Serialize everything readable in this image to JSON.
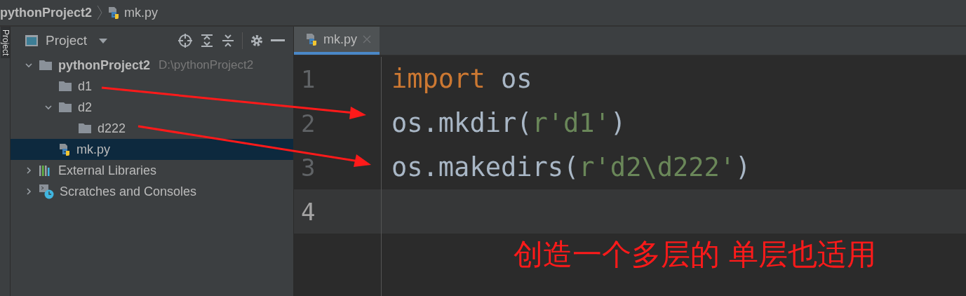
{
  "breadcrumb": {
    "project": "pythonProject2",
    "file": "mk.py"
  },
  "side_strip": {
    "label": "Project"
  },
  "project_panel": {
    "title": "Project",
    "tree": [
      {
        "label": "pythonProject2",
        "hint": "D:\\pythonProject2",
        "kind": "root",
        "expanded": true,
        "selected": false,
        "children": [
          {
            "label": "d1",
            "kind": "folder",
            "selected": false
          },
          {
            "label": "d2",
            "kind": "folder",
            "expanded": true,
            "selected": false,
            "children": [
              {
                "label": "d222",
                "kind": "folder",
                "selected": false
              }
            ]
          },
          {
            "label": "mk.py",
            "kind": "python",
            "selected": true
          }
        ]
      },
      {
        "label": "External Libraries",
        "kind": "libraries",
        "expanded": false,
        "selected": false
      },
      {
        "label": "Scratches and Consoles",
        "kind": "scratches",
        "expanded": false,
        "selected": false
      }
    ]
  },
  "editor": {
    "tabs": [
      {
        "label": "mk.py",
        "selected": true
      }
    ],
    "lines": [
      {
        "number": "1",
        "current": false,
        "tokens": [
          {
            "text": "import",
            "kind": "keyword"
          },
          {
            "text": " os",
            "kind": "plain"
          }
        ]
      },
      {
        "number": "2",
        "current": false,
        "tokens": [
          {
            "text": "os.mkdir(",
            "kind": "plain"
          },
          {
            "text": "r'd1'",
            "kind": "string"
          },
          {
            "text": ")",
            "kind": "plain"
          }
        ]
      },
      {
        "number": "3",
        "current": false,
        "tokens": [
          {
            "text": "os.makedirs(",
            "kind": "plain"
          },
          {
            "text": "r'd2\\d222'",
            "kind": "string"
          },
          {
            "text": ")",
            "kind": "plain"
          }
        ]
      },
      {
        "number": "4",
        "current": true
      }
    ]
  },
  "annotation": "创造一个多层的 单层也适用"
}
